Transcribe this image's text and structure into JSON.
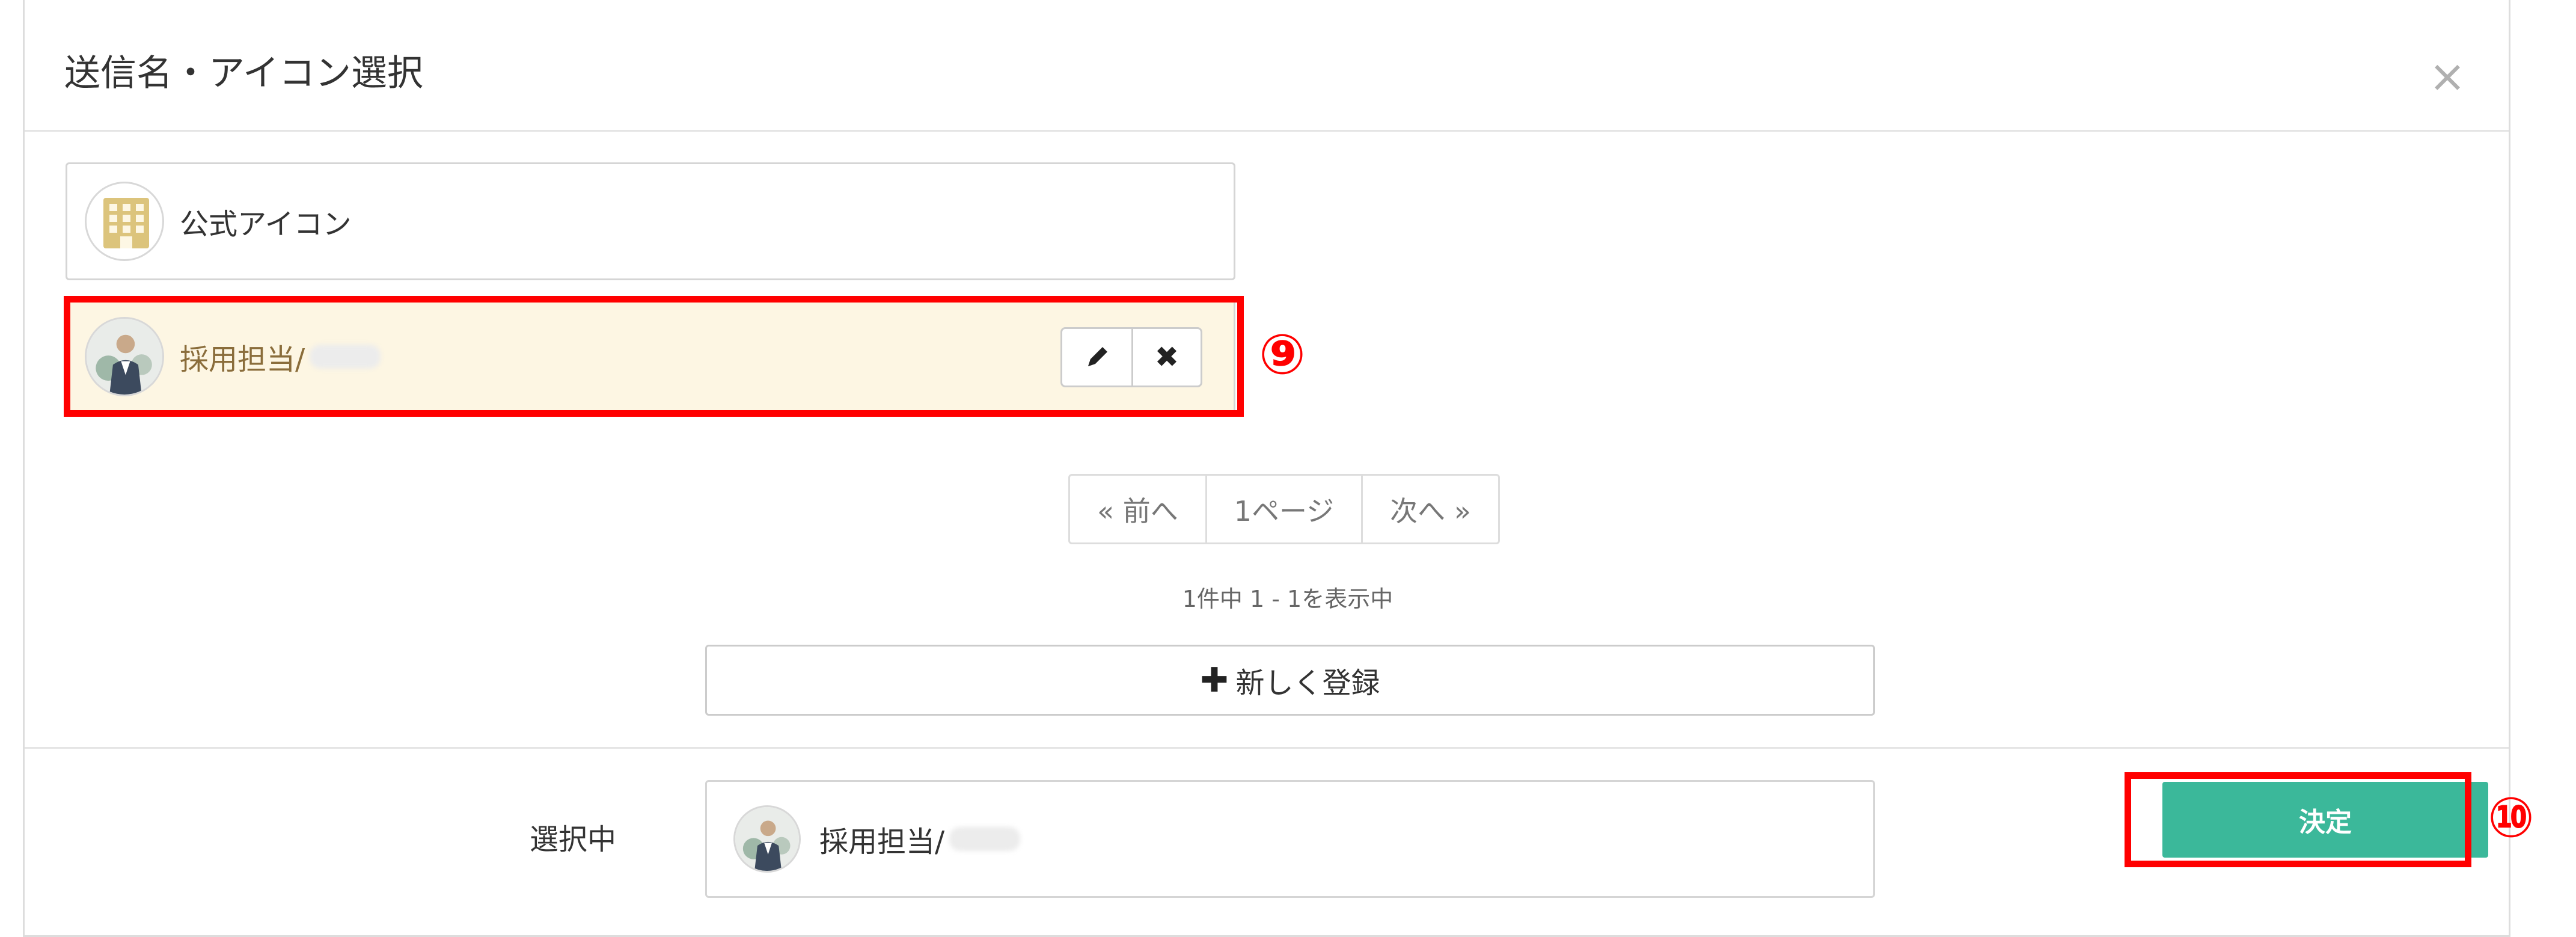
{
  "dialog": {
    "title": "送信名・アイコン選択",
    "close_label": "×"
  },
  "senders": [
    {
      "name": "公式アイコン",
      "icon": "building-icon",
      "selected": false
    },
    {
      "name": "採用担当/",
      "icon": "person-avatar-icon",
      "selected": true
    }
  ],
  "actions": {
    "edit_icon": "pencil-icon",
    "delete_label": "✖"
  },
  "annotations": {
    "item_marker": "⑨",
    "confirm_marker": "⑩",
    "highlight_color": "#ff0000"
  },
  "pagination": {
    "prev": "« 前へ",
    "current": "1ページ",
    "next": "次へ »"
  },
  "count_text": "1件中 1 - 1を表示中",
  "register": {
    "plus": "✚",
    "label": "新しく登録"
  },
  "selection": {
    "label": "選択中",
    "name": "採用担当/"
  },
  "confirm_label": "決定",
  "colors": {
    "confirm_button": "#3bb89a",
    "selected_row": "#fdf6e3",
    "selected_text": "#8a6d3b",
    "building_icon": "#dcc47c"
  }
}
